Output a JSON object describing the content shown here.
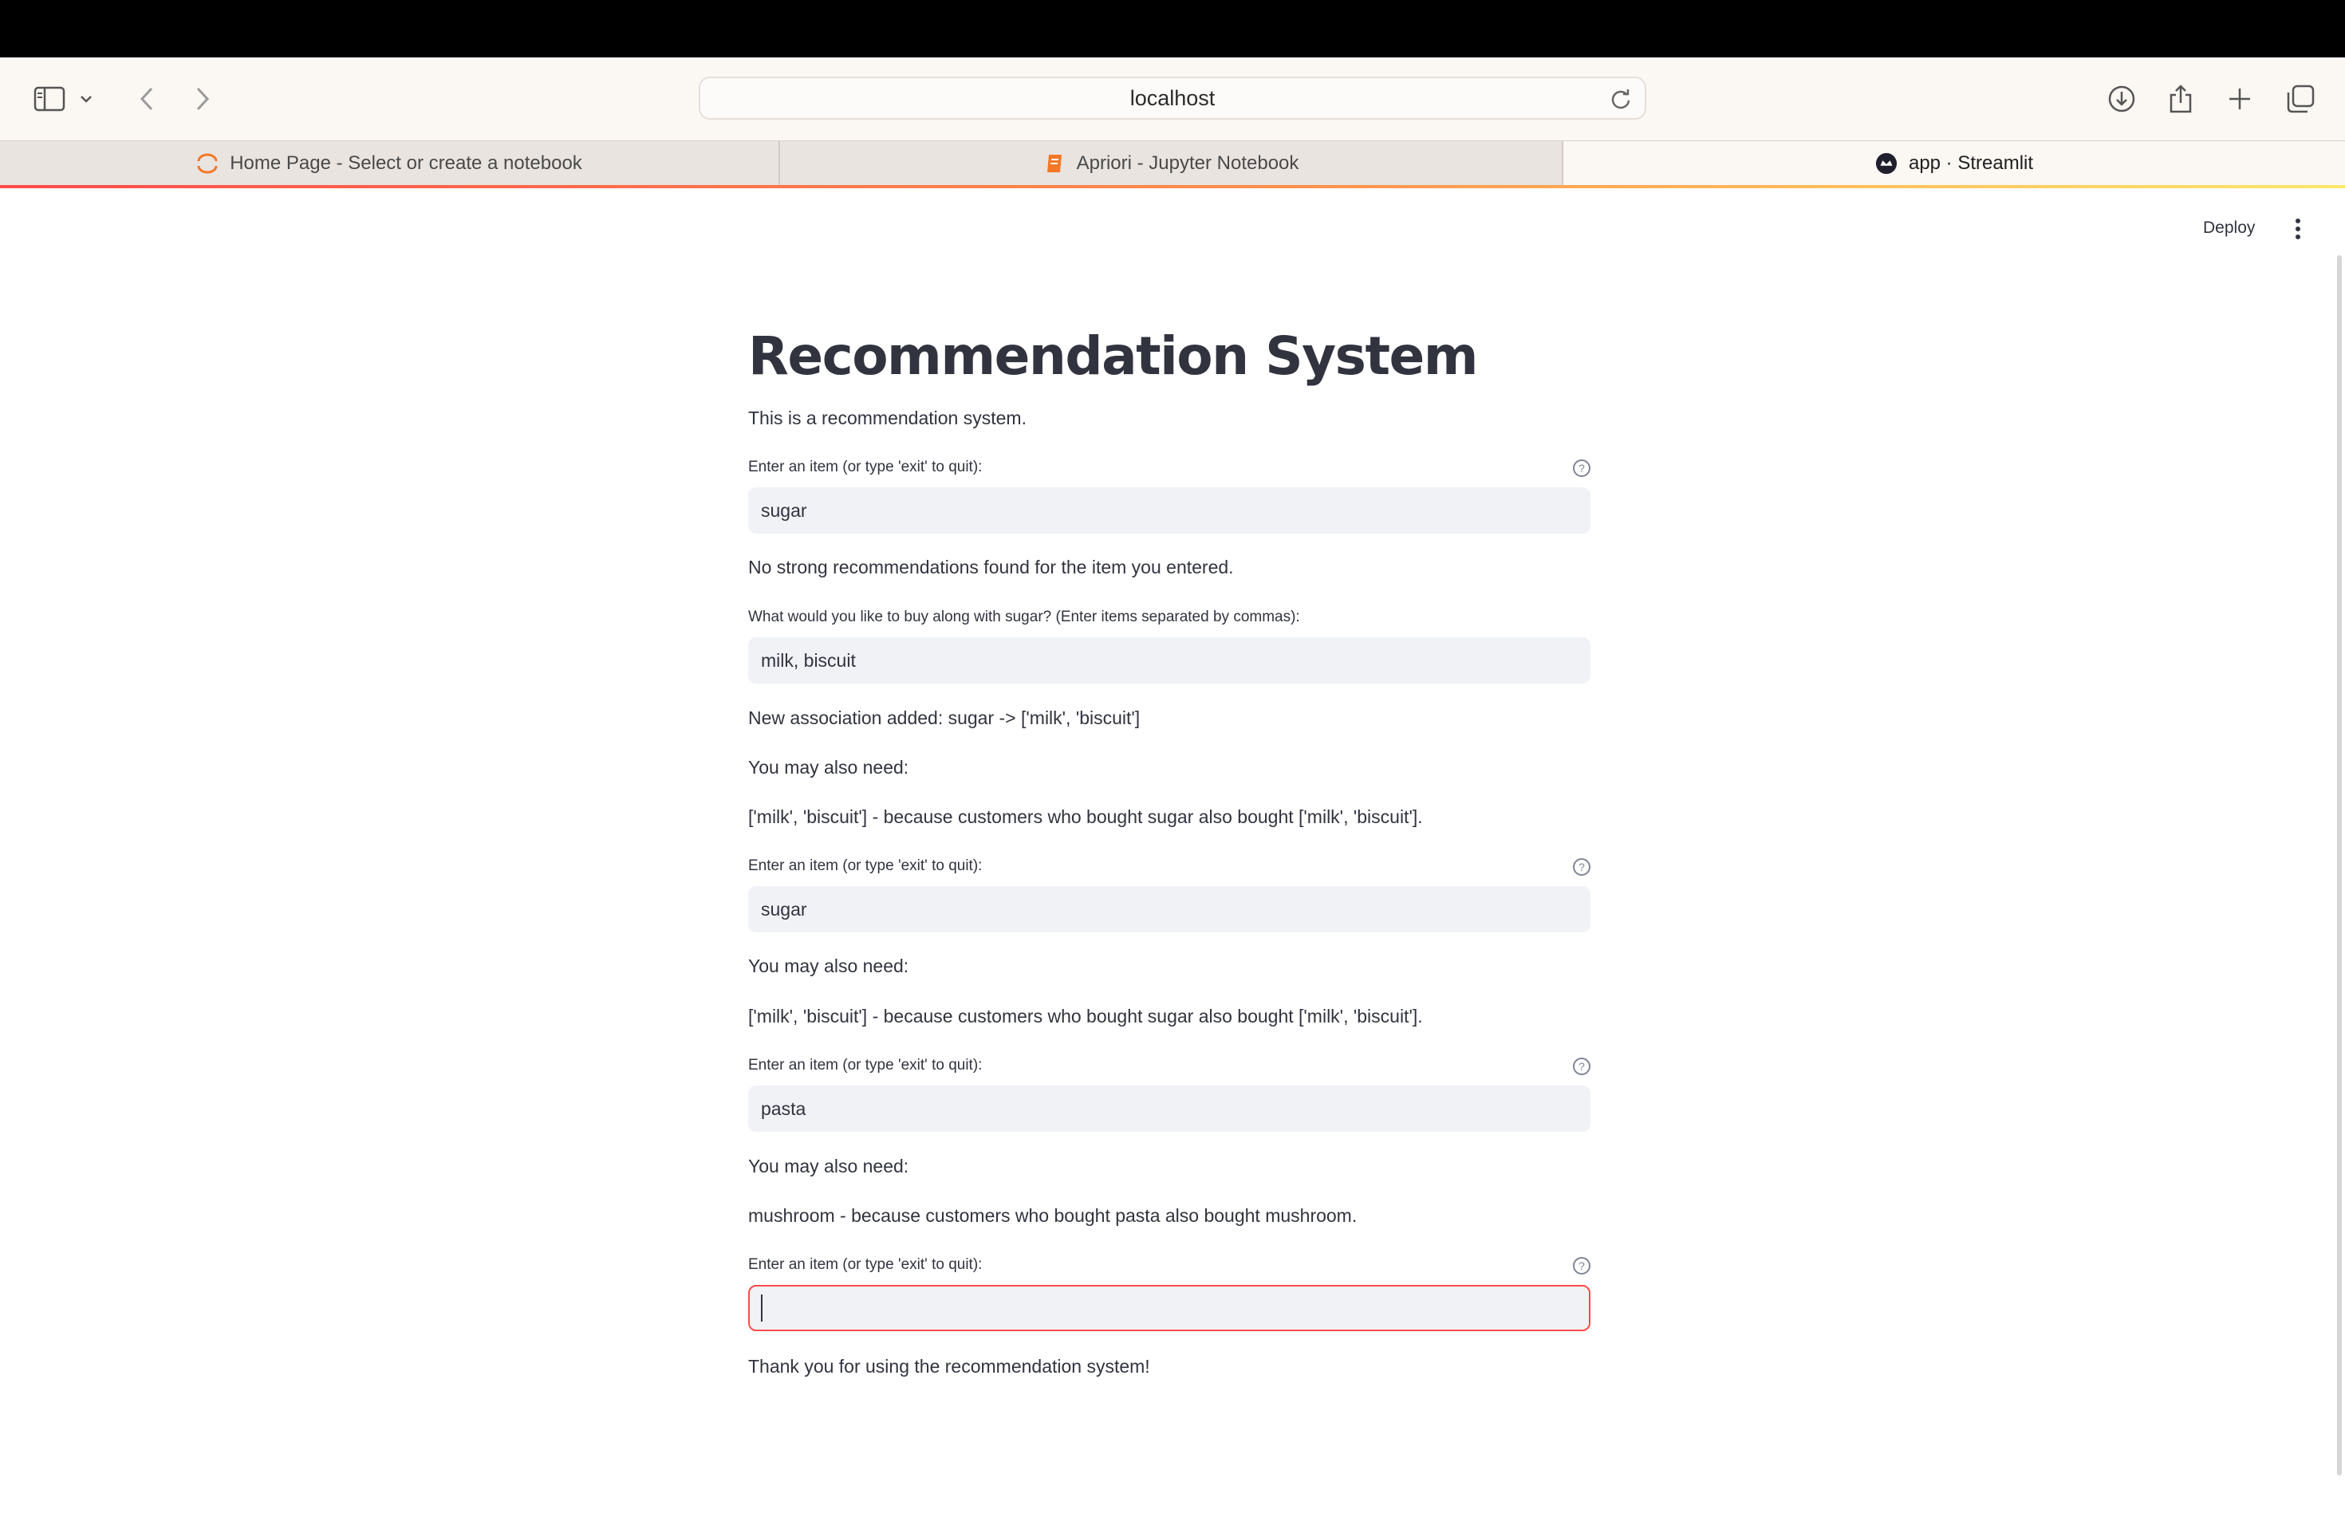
{
  "browser": {
    "address": "localhost",
    "tabs": [
      {
        "label": "Home Page - Select or create a notebook",
        "icon": "jupyter-icon"
      },
      {
        "label": "Apriori - Jupyter Notebook",
        "icon": "notebook-icon"
      },
      {
        "label": "app · Streamlit",
        "icon": "streamlit-icon"
      }
    ]
  },
  "app": {
    "deploy_label": "Deploy",
    "title": "Recommendation System",
    "intro": "This is a recommendation system.",
    "blocks": {
      "label_item": "Enter an item (or type 'exit' to quit):",
      "input1_value": "sugar",
      "no_reco": "No strong recommendations found for the item you entered.",
      "label_buy_along": "What would you like to buy along with sugar? (Enter items separated by commas):",
      "input2_value": "milk, biscuit",
      "assoc_added": "New association added: sugar -> ['milk', 'biscuit']",
      "may_need": "You may also need:",
      "reco_sugar": "['milk', 'biscuit'] - because customers who bought sugar also bought ['milk', 'biscuit'].",
      "input3_value": "sugar",
      "input4_value": "pasta",
      "reco_pasta": "mushroom - because customers who bought pasta also bought mushroom.",
      "input5_value": "",
      "thanks": "Thank you for using the recommendation system!"
    },
    "colors": {
      "accent": "#ff4b4b",
      "text": "#31333f",
      "input_bg": "#f0f2f6"
    }
  }
}
